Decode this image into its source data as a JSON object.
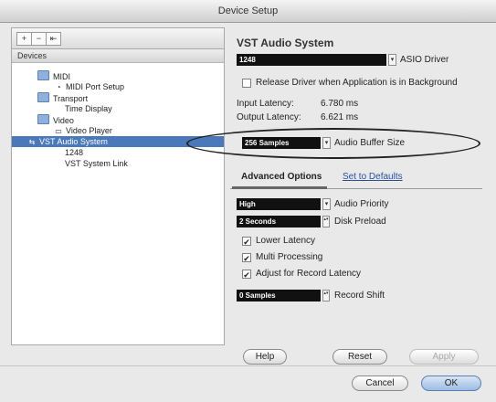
{
  "window": {
    "title": "Device Setup"
  },
  "toolbar": {
    "add": "+",
    "remove": "−",
    "reset": "⇤"
  },
  "devices": {
    "header": "Devices",
    "items": [
      {
        "label": "MIDI"
      },
      {
        "label": "MIDI Port Setup"
      },
      {
        "label": "Transport"
      },
      {
        "label": "Time Display"
      },
      {
        "label": "Video"
      },
      {
        "label": "Video Player"
      },
      {
        "label": "VST Audio System"
      },
      {
        "label": "1248"
      },
      {
        "label": "VST System Link"
      }
    ]
  },
  "panel": {
    "title": "VST Audio System",
    "driver_value": "1248",
    "driver_label": "ASIO Driver",
    "release_driver_label": "Release Driver when Application is in Background",
    "input_latency_label": "Input Latency:",
    "input_latency_value": "6.780 ms",
    "output_latency_label": "Output Latency:",
    "output_latency_value": "6.621 ms",
    "buffer_value": "256 Samples",
    "buffer_label": "Audio Buffer Size",
    "advanced_tab": "Advanced Options",
    "defaults_link": "Set to Defaults",
    "priority_value": "High",
    "priority_label": "Audio Priority",
    "preload_value": "2 Seconds",
    "preload_label": "Disk Preload",
    "lower_latency_label": "Lower Latency",
    "multi_processing_label": "Multi Processing",
    "adjust_record_label": "Adjust for Record Latency",
    "record_shift_value": "0 Samples",
    "record_shift_label": "Record Shift"
  },
  "buttons": {
    "help": "Help",
    "reset": "Reset",
    "apply": "Apply",
    "cancel": "Cancel",
    "ok": "OK"
  },
  "icons": {
    "check": "✔",
    "dropdown": "▾",
    "stepper": "▴▾"
  }
}
